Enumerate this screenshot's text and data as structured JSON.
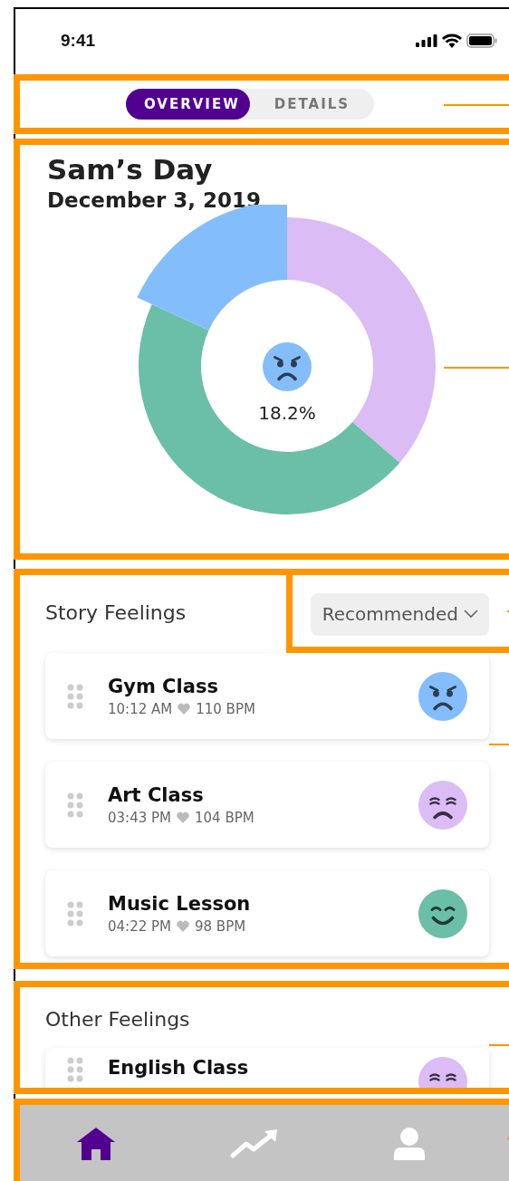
{
  "status_bar": {
    "time": "9:41"
  },
  "tabs": [
    {
      "label": "OVERVIEW",
      "selected": true
    },
    {
      "label": "DETAILS",
      "selected": false
    }
  ],
  "summary": {
    "title": "Sam’s Day",
    "date": "December 3, 2019",
    "chart": {
      "segments": [
        {
          "color": "#dbbcf5",
          "selected": false
        },
        {
          "color": "#6bbfa6",
          "selected": false
        },
        {
          "color": "#84bdfc",
          "selected": true
        }
      ],
      "center": {
        "kind": "angry",
        "color": "#84bdfc",
        "value": "18.2%"
      }
    }
  },
  "story_feelings": {
    "title": "Story Feelings",
    "sort": "Recommended",
    "items": [
      {
        "name": "Gym Class",
        "time": "10:12 AM",
        "bpm": "110 BPM",
        "kind": "angry",
        "color": "#84bdfc"
      },
      {
        "name": "Art Class",
        "time": "03:43 PM",
        "bpm": "104 BPM",
        "kind": "sad",
        "color": "#dbbcf5"
      },
      {
        "name": "Music Lesson",
        "time": "04:22 PM",
        "bpm": "98 BPM",
        "kind": "happy",
        "color": "#6bbfa6"
      }
    ]
  },
  "other_feelings": {
    "title": "Other Feelings",
    "items": [
      {
        "name": "English Class",
        "kind": "sad",
        "color": "#dbbcf5"
      }
    ]
  },
  "nav": [
    {
      "kind": "home",
      "selected": true
    },
    {
      "kind": "trend",
      "selected": false
    },
    {
      "kind": "profile",
      "selected": false
    }
  ]
}
